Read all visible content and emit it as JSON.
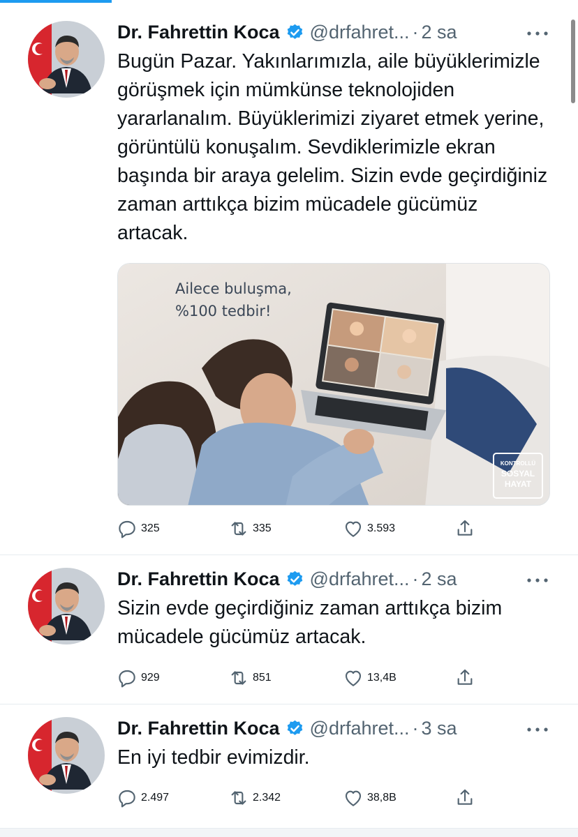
{
  "tweets": [
    {
      "author_name": "Dr. Fahrettin Koca",
      "handle": "@drfahret...",
      "separator": "·",
      "time": "2 sa",
      "text": "Bugün Pazar. Yakınlarımızla, aile büyüklerimizle görüşmek için mümkünse teknolojiden yararlanalım. Büyüklerimizi ziyaret etmek yerine, görüntülü konuşalım. Sevdiklerimizle ekran başında bir araya gelelim. Sizin evde geçirdiğiniz zaman arttıkça bizim mücadele gücümüz artacak.",
      "media": {
        "caption_line1": "Ailece buluşma,",
        "caption_line2": "%100 tedbir!",
        "badge_line1": "KONTROLLÜ",
        "badge_line2": "SOSYAL",
        "badge_line3": "HAYAT"
      },
      "replies": "325",
      "retweets": "335",
      "likes": "3.593"
    },
    {
      "author_name": "Dr. Fahrettin Koca",
      "handle": "@drfahret...",
      "separator": "·",
      "time": "2 sa",
      "text": "Sizin evde geçirdiğiniz zaman arttıkça bizim mücadele gücümüz artacak.",
      "replies": "929",
      "retweets": "851",
      "likes": "13,4B"
    },
    {
      "author_name": "Dr. Fahrettin Koca",
      "handle": "@drfahret...",
      "separator": "·",
      "time": "3 sa",
      "text": "En iyi tedbir evimizdir.",
      "replies": "2.497",
      "retweets": "2.342",
      "likes": "38,8B"
    }
  ],
  "icons": {
    "reply": "reply-icon",
    "retweet": "retweet-icon",
    "like": "heart-icon",
    "share": "share-icon",
    "verified": "verified-badge-icon",
    "more": "more-icon"
  },
  "colors": {
    "accent": "#1d9bf0",
    "muted_text": "#536471",
    "main_text": "#0f1419",
    "divider": "#e6ecf0"
  }
}
